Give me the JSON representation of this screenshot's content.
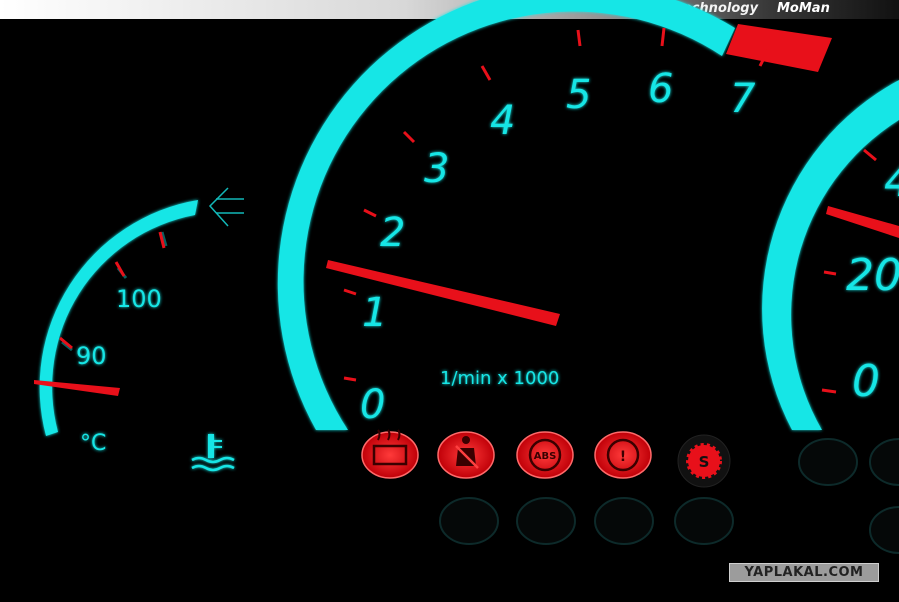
{
  "header": {
    "tagline": "indiglo technology",
    "brand": "MoMan"
  },
  "watermark": "YAPLAKAL.COM",
  "temperature_gauge": {
    "labels": [
      "90",
      "100"
    ],
    "unit": "°C",
    "icon": "coolant-temperature-icon"
  },
  "tachometer": {
    "labels": [
      "0",
      "1",
      "2",
      "3",
      "4",
      "5",
      "6",
      "7"
    ],
    "unit": "1/min x 1000",
    "redline_color": "#e8101a"
  },
  "speedometer": {
    "labels": [
      "0",
      "20",
      "4"
    ]
  },
  "warning_lights": [
    {
      "icon": "catalytic-converter-icon",
      "lit": true
    },
    {
      "icon": "seatbelt-icon",
      "lit": true
    },
    {
      "icon": "abs-icon",
      "label": "ABS",
      "lit": true
    },
    {
      "icon": "brake-warning-icon",
      "label": "!",
      "lit": true
    },
    {
      "icon": "sport-mode-icon",
      "label": "S",
      "lit": true
    }
  ],
  "colors": {
    "backlight": "#17e6e6",
    "needle": "#e8101a",
    "background": "#000000"
  }
}
